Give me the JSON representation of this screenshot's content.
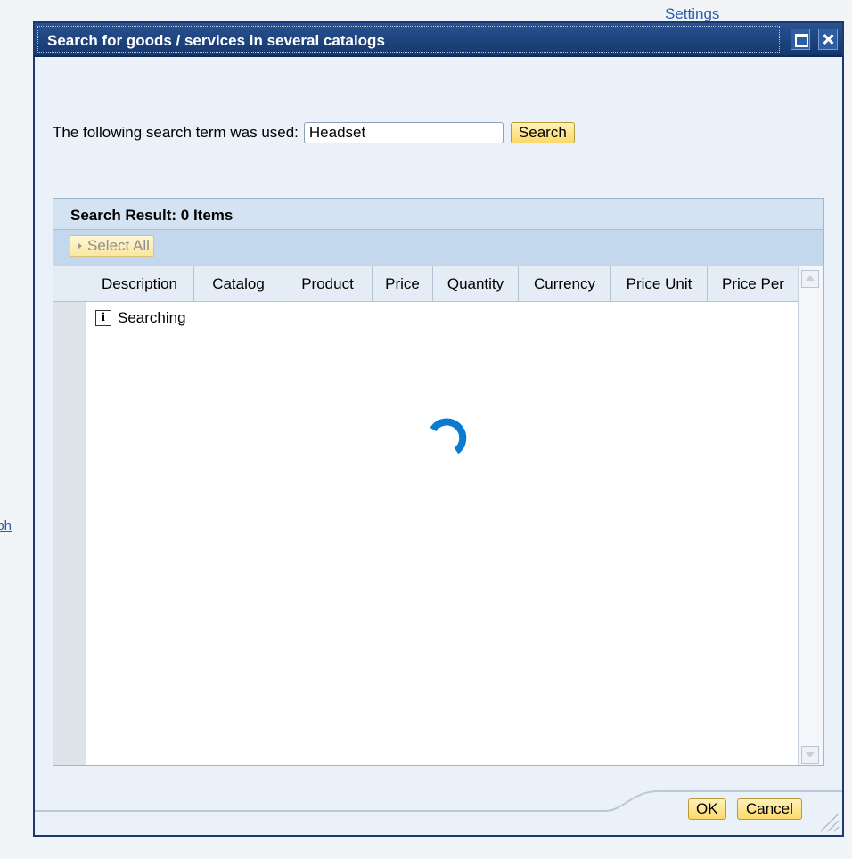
{
  "background": {
    "settings_link": "Settings",
    "left_link_fragment": "nbh"
  },
  "dialog": {
    "title": "Search for goods / services in several catalogs",
    "search_label": "The following search term was used:",
    "search_value": "Headset",
    "search_button": "Search",
    "result_title": "Search Result: 0  Items",
    "select_all": "Select All",
    "columns": [
      "Description",
      "Catalog",
      "Product",
      "Price",
      "Quantity",
      "Currency",
      "Price Unit",
      "Price Per"
    ],
    "status_text": "Searching",
    "ok_button": "OK",
    "cancel_button": "Cancel"
  },
  "icons": {
    "maximize": "maximize-icon",
    "close": "close-icon",
    "info": "info-icon",
    "spinner": "loading-spinner-icon",
    "corner": "column-selector-icon"
  },
  "colors": {
    "titlebar": "#1c3a71",
    "button": "#fbd96a",
    "spinner": "#0a7bd0",
    "panel_header": "#d4e3f2"
  }
}
